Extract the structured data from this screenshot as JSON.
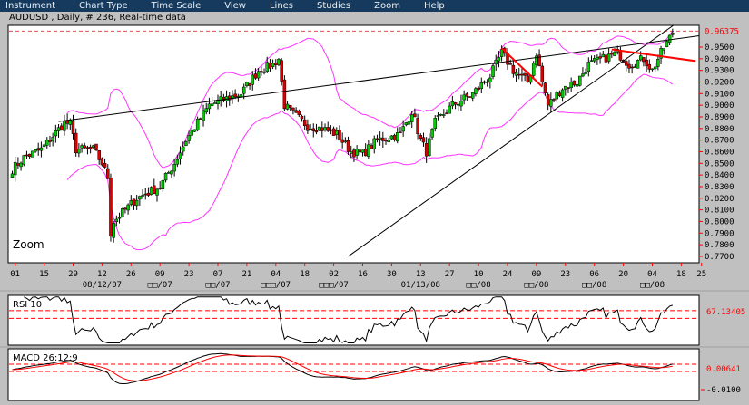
{
  "menu": [
    "Instrument",
    "Chart Type",
    "Time Scale",
    "View",
    "Lines",
    "Studies",
    "Zoom",
    "Help"
  ],
  "title": "AUDUSD , Daily, # 236, Real-time data",
  "zoom_label": "Zoom",
  "rsi_label": "RSI 10",
  "macd_label": "MACD 26:12:9",
  "rsi_value": "67.13405",
  "macd_value": "0.00641",
  "macd_axis_label": "-0.0100",
  "colors": {
    "up": "#00cc00",
    "down": "#dd0000",
    "band": "#ff33ff",
    "accent": "#ff0000",
    "menu": "#163a5e"
  },
  "chart_data": {
    "type": "candlestick",
    "symbol": "AUDUSD",
    "ylim": [
      0.765,
      0.968
    ],
    "current_price": "0.96375",
    "y_ticks": [
      "0.9500",
      "0.9400",
      "0.9300",
      "0.9200",
      "0.9100",
      "0.9000",
      "0.8900",
      "0.8800",
      "0.8700",
      "0.8600",
      "0.8500",
      "0.8400",
      "0.8300",
      "0.8200",
      "0.8100",
      "0.8000",
      "0.7900",
      "0.7800",
      "0.7700"
    ],
    "x_ticks": [
      "01",
      "15",
      "29",
      "12",
      "26",
      "09",
      "23",
      "07",
      "21",
      "04",
      "18",
      "02",
      "16",
      "30",
      "13",
      "27",
      "10",
      "24",
      "09",
      "23",
      "06",
      "20",
      "04",
      "18",
      "25"
    ],
    "x_tick_index": [
      1,
      11,
      21,
      31,
      41,
      51,
      61,
      71,
      81,
      91,
      101,
      111,
      121,
      131,
      141,
      151,
      161,
      171,
      181,
      191,
      201,
      211,
      221,
      231,
      238
    ],
    "month_labels": [
      "08/12/07",
      "□□/07",
      "□□/07",
      "□□□/07",
      "□□□/07",
      "01/13/08",
      "□□/08",
      "□□/08",
      "□□/08",
      "□□/08"
    ],
    "month_label_index": [
      31,
      51,
      71,
      91,
      111,
      141,
      161,
      181,
      201,
      221
    ],
    "candle_count": 229,
    "close_keypoints": [
      [
        0,
        0.845
      ],
      [
        4,
        0.855
      ],
      [
        10,
        0.862
      ],
      [
        18,
        0.885
      ],
      [
        20,
        0.884
      ],
      [
        22,
        0.862
      ],
      [
        28,
        0.862
      ],
      [
        31,
        0.85
      ],
      [
        33,
        0.838
      ],
      [
        34,
        0.79
      ],
      [
        35,
        0.8
      ],
      [
        43,
        0.82
      ],
      [
        51,
        0.83
      ],
      [
        56,
        0.85
      ],
      [
        60,
        0.87
      ],
      [
        68,
        0.9
      ],
      [
        73,
        0.905
      ],
      [
        79,
        0.91
      ],
      [
        85,
        0.93
      ],
      [
        90,
        0.935
      ],
      [
        92,
        0.94
      ],
      [
        94,
        0.9
      ],
      [
        96,
        0.895
      ],
      [
        102,
        0.882
      ],
      [
        107,
        0.88
      ],
      [
        112,
        0.875
      ],
      [
        117,
        0.86
      ],
      [
        121,
        0.858
      ],
      [
        126,
        0.87
      ],
      [
        134,
        0.875
      ],
      [
        138,
        0.895
      ],
      [
        141,
        0.87
      ],
      [
        143,
        0.86
      ],
      [
        146,
        0.885
      ],
      [
        152,
        0.9
      ],
      [
        159,
        0.91
      ],
      [
        165,
        0.925
      ],
      [
        169,
        0.945
      ],
      [
        173,
        0.93
      ],
      [
        178,
        0.92
      ],
      [
        181,
        0.945
      ],
      [
        183,
        0.92
      ],
      [
        185,
        0.9
      ],
      [
        190,
        0.915
      ],
      [
        195,
        0.92
      ],
      [
        199,
        0.935
      ],
      [
        204,
        0.94
      ],
      [
        209,
        0.945
      ],
      [
        213,
        0.935
      ],
      [
        218,
        0.94
      ],
      [
        221,
        0.93
      ],
      [
        224,
        0.945
      ],
      [
        227,
        0.958
      ],
      [
        228,
        0.963
      ]
    ],
    "trendlines": [
      {
        "color": "#000000",
        "from": [
          16,
          0.886
        ],
        "to": [
          256,
          0.966
        ]
      },
      {
        "color": "#000000",
        "from": [
          116,
          0.77
        ],
        "to": [
          229,
          0.97
        ]
      },
      {
        "color": "#ff0000",
        "from": [
          169,
          0.949
        ],
        "to": [
          183,
          0.916
        ]
      },
      {
        "color": "#ff0000",
        "from": [
          207,
          0.948
        ],
        "to": [
          236,
          0.938
        ]
      }
    ],
    "rsi_levels": [
      70,
      60
    ],
    "indicators": [
      "Bollinger Bands 20,2",
      "RSI 10",
      "MACD 26:12:9"
    ]
  }
}
